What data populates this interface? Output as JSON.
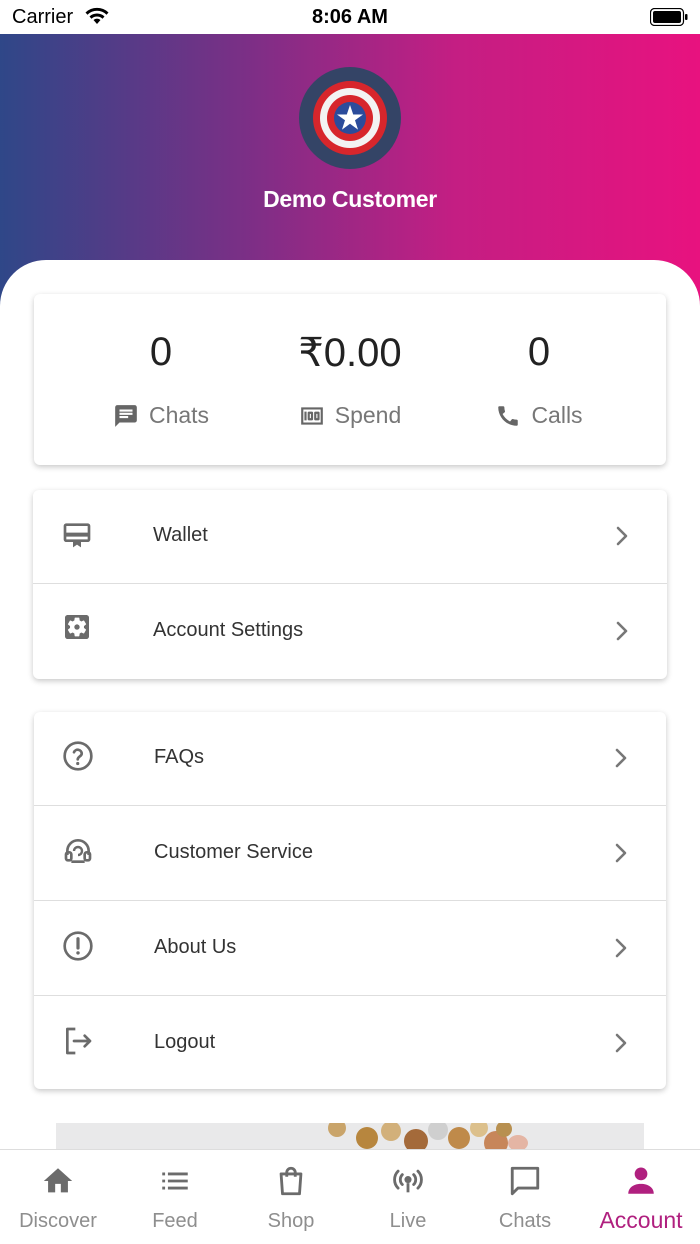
{
  "status_bar": {
    "carrier": "Carrier",
    "time": "8:06 AM"
  },
  "profile": {
    "name": "Demo Customer"
  },
  "stats": [
    {
      "value": "0",
      "label": "Chats",
      "icon": "chat-icon"
    },
    {
      "value": "₹0.00",
      "label": "Spend",
      "icon": "money-icon"
    },
    {
      "value": "0",
      "label": "Calls",
      "icon": "phone-icon"
    }
  ],
  "menu_group_1": [
    {
      "label": "Wallet",
      "icon": "wallet-icon"
    },
    {
      "label": "Account Settings",
      "icon": "settings-icon"
    }
  ],
  "menu_group_2": [
    {
      "label": "FAQs",
      "icon": "help-icon"
    },
    {
      "label": "Customer Service",
      "icon": "headset-icon"
    },
    {
      "label": "About Us",
      "icon": "info-icon"
    },
    {
      "label": "Logout",
      "icon": "logout-icon"
    }
  ],
  "bottom_nav": [
    {
      "label": "Discover",
      "icon": "home-icon",
      "active": false
    },
    {
      "label": "Feed",
      "icon": "list-icon",
      "active": false
    },
    {
      "label": "Shop",
      "icon": "bag-icon",
      "active": false
    },
    {
      "label": "Live",
      "icon": "broadcast-icon",
      "active": false
    },
    {
      "label": "Chats",
      "icon": "chat-bubble-icon",
      "active": false
    },
    {
      "label": "Account",
      "icon": "person-icon",
      "active": true
    }
  ],
  "colors": {
    "accent": "#b0207f",
    "gradient_start": "#2f4788",
    "gradient_end": "#e8127f",
    "icon_gray": "#6b6b6b"
  }
}
